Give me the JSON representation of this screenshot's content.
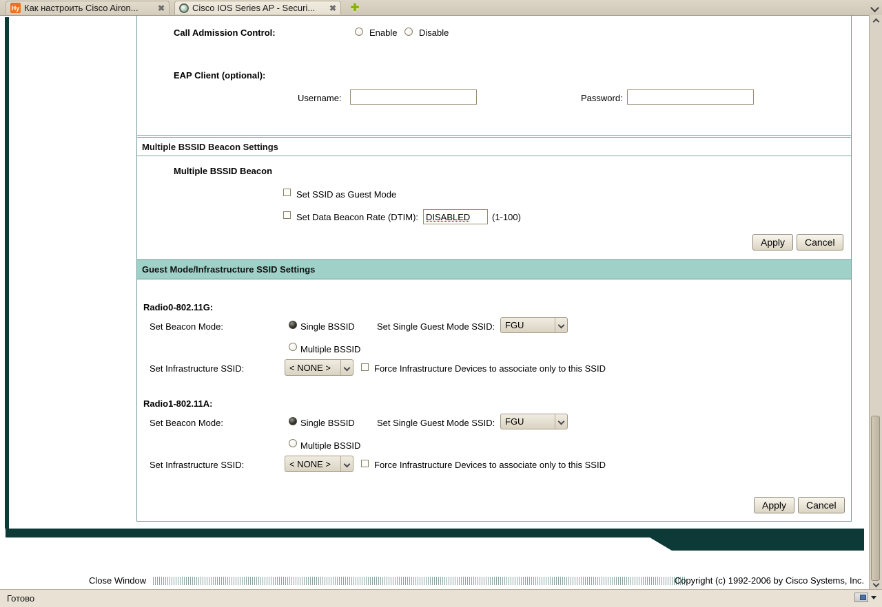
{
  "icons": {
    "close": "✖",
    "new_tab": "✚",
    "favicon_habr": "Hy"
  },
  "tab_bar": {
    "tabs": [
      {
        "title": "Как настроить Cisco Airon..."
      },
      {
        "title": "Cisco IOS Series AP - Securi..."
      }
    ]
  },
  "form": {
    "call_admission": {
      "label": "Call Admission Control:",
      "enable_label": "Enable",
      "disable_label": "Disable"
    },
    "eap": {
      "label": "EAP Client (optional):",
      "username_label": "Username:",
      "username_value": "",
      "password_label": "Password:",
      "password_value": ""
    },
    "beacon": {
      "header": "Multiple BSSID Beacon Settings",
      "title": "Multiple BSSID Beacon",
      "guest_mode_checkbox": "Set SSID as Guest Mode",
      "dtim_checkbox": "Set Data Beacon Rate (DTIM):",
      "dtim_value": "DISABLED",
      "dtim_range": "(1-100)"
    },
    "buttons": {
      "apply": "Apply",
      "cancel": "Cancel"
    },
    "guest": {
      "header": "Guest Mode/Infrastructure SSID Settings",
      "radios": [
        {
          "title": "Radio0-802.11G:",
          "beacon_mode_label": "Set Beacon Mode:",
          "single_label": "Single BSSID",
          "guest_ssid_label": "Set Single Guest Mode SSID:",
          "guest_ssid_value": "FGU",
          "multiple_label": "Multiple BSSID",
          "infra_label": "Set Infrastructure SSID:",
          "infra_value": "< NONE >",
          "force_label": "Force Infrastructure Devices to associate only to this SSID"
        },
        {
          "title": "Radio1-802.11A:",
          "beacon_mode_label": "Set Beacon Mode:",
          "single_label": "Single BSSID",
          "guest_ssid_label": "Set Single Guest Mode SSID:",
          "guest_ssid_value": "FGU",
          "multiple_label": "Multiple BSSID",
          "infra_label": "Set Infrastructure SSID:",
          "infra_value": "< NONE >",
          "force_label": "Force Infrastructure Devices to associate only to this SSID"
        }
      ]
    }
  },
  "footer": {
    "close_window": "Close Window",
    "copyright": "Copyright (c) 1992-2006 by Cisco Systems, Inc."
  },
  "status_bar": {
    "text": "Готово"
  },
  "colors": {
    "dark_teal": "#0d3a37",
    "panel_border": "#6f9f9c",
    "section_header_bg": "#9fd1c9"
  }
}
